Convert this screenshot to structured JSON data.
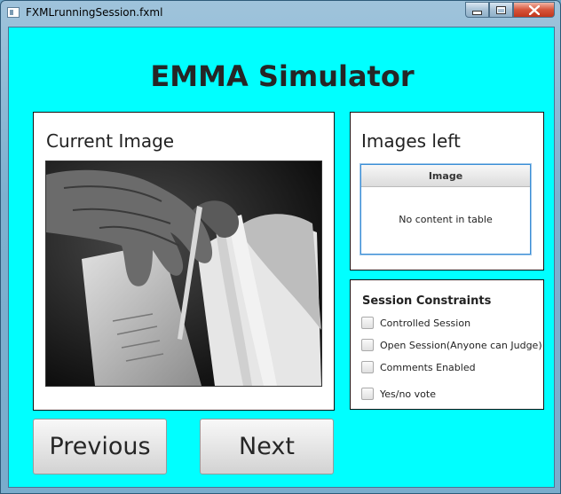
{
  "window": {
    "title": "FXMLrunningSession.fxml"
  },
  "app": {
    "title": "EMMA Simulator"
  },
  "current_image": {
    "label": "Current Image",
    "image_description_icon": "photo-icon"
  },
  "images_left": {
    "label": "Images left",
    "table": {
      "columns": [
        "Image"
      ],
      "rows": [],
      "empty_text": "No content in table"
    }
  },
  "session_constraints": {
    "title": "Session Constraints",
    "options": [
      {
        "label": "Controlled Session",
        "checked": false
      },
      {
        "label": "Open Session(Anyone can Judge)",
        "checked": false
      },
      {
        "label": "Comments Enabled",
        "checked": false
      },
      {
        "label": "Yes/no vote",
        "checked": false
      }
    ]
  },
  "buttons": {
    "previous": "Previous",
    "next": "Next"
  },
  "colors": {
    "background": "#00ffff",
    "panel": "#ffffff",
    "table_focus_border": "#3a8ed6"
  }
}
